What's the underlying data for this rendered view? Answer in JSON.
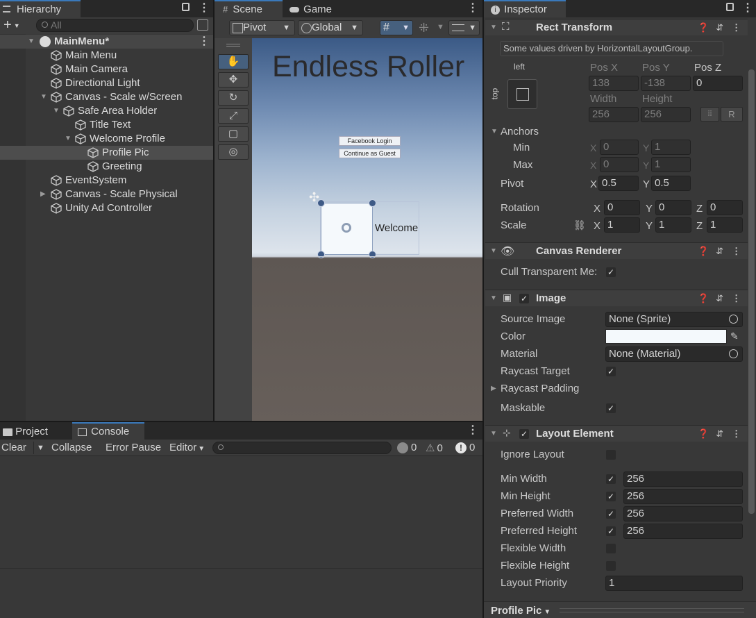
{
  "hierarchy": {
    "tab": "Hierarchy",
    "search_placeholder": "All",
    "add": "+",
    "items": [
      "MainMenu*",
      "Main Menu",
      "Main Camera",
      "Directional Light",
      "Canvas - Scale w/Screen",
      "Safe Area Holder",
      "Title Text",
      "Welcome Profile",
      "Profile Pic",
      "Greeting",
      "EventSystem",
      "Canvas - Scale Physical",
      "Unity Ad Controller"
    ]
  },
  "scene": {
    "tab_scene": "Scene",
    "tab_game": "Game",
    "pivot": "Pivot",
    "global": "Global",
    "title": "Endless Roller",
    "btn_fb": "Facebook Login",
    "btn_guest": "Continue as Guest",
    "welcome": "Welcome"
  },
  "console": {
    "tab_project": "Project",
    "tab_console": "Console",
    "clear": "Clear",
    "collapse": "Collapse",
    "error_pause": "Error Pause",
    "editor": "Editor",
    "count_info": "0",
    "count_warn": "0",
    "count_err": "0"
  },
  "inspector": {
    "tab": "Inspector",
    "rect": {
      "title": "Rect Transform",
      "note": "Some values driven by HorizontalLayoutGroup.",
      "anchor_h": "left",
      "anchor_v": "top",
      "posx_label": "Pos X",
      "posy_label": "Pos Y",
      "posz_label": "Pos Z",
      "posx": "138",
      "posy": "-138",
      "posz": "0",
      "width_label": "Width",
      "height_label": "Height",
      "width": "256",
      "height": "256",
      "raw_btn": "R",
      "anchors": "Anchors",
      "min": "Min",
      "max": "Max",
      "min_x": "0",
      "min_y": "1",
      "max_x": "0",
      "max_y": "1",
      "pivot": "Pivot",
      "pivot_x": "0.5",
      "pivot_y": "0.5",
      "rotation": "Rotation",
      "rot_x": "0",
      "rot_y": "0",
      "rot_z": "0",
      "scale": "Scale",
      "scale_x": "1",
      "scale_y": "1",
      "scale_z": "1",
      "x": "X",
      "y": "Y",
      "z": "Z"
    },
    "canvas_renderer": {
      "title": "Canvas Renderer",
      "cull": "Cull Transparent Me:"
    },
    "image": {
      "title": "Image",
      "source_label": "Source Image",
      "source": "None (Sprite)",
      "color_label": "Color",
      "material_label": "Material",
      "material": "None (Material)",
      "raycast_target": "Raycast Target",
      "raycast_padding": "Raycast Padding",
      "maskable": "Maskable",
      "color": "#f4f9fc"
    },
    "layout": {
      "title": "Layout Element",
      "ignore": "Ignore Layout",
      "min_w": "Min Width",
      "min_h": "Min Height",
      "pref_w": "Preferred Width",
      "pref_h": "Preferred Height",
      "flex_w": "Flexible Width",
      "flex_h": "Flexible Height",
      "priority": "Layout Priority",
      "min_w_v": "256",
      "min_h_v": "256",
      "pref_w_v": "256",
      "pref_h_v": "256",
      "priority_v": "1"
    },
    "footer": "Profile Pic"
  }
}
